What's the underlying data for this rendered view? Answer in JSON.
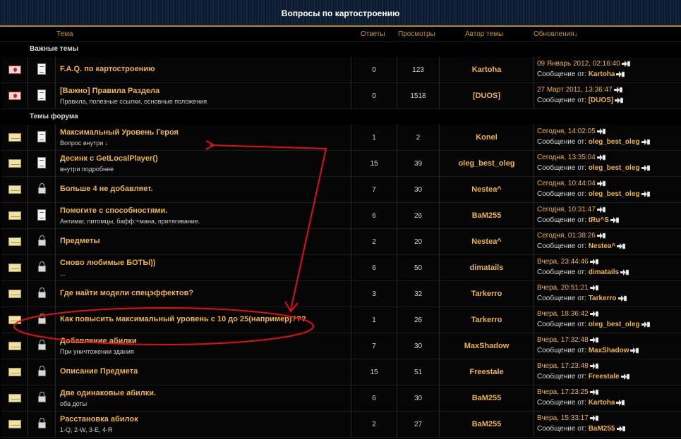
{
  "banner": {
    "title": "Вопросы по картостроению"
  },
  "columns": {
    "topic": "Тема",
    "replies": "Ответы",
    "views": "Просмотры",
    "author": "Автор темы",
    "updates": "Обновления↓"
  },
  "sections": {
    "important": "Важные темы",
    "forum": "Темы форума"
  },
  "important_topics": [
    {
      "title": "F.A.Q. по картостроению",
      "desc": "",
      "replies": "0",
      "views": "123",
      "author": "Kartoha",
      "updated": "09 Январь 2012, 02:16:40",
      "msg_prefix": "Сообщение от:",
      "msg_author": "Kartoha"
    },
    {
      "title": "[Важно] Правила Раздела",
      "desc": "Правила, полезные ссылки, основные положения",
      "replies": "0",
      "views": "1518",
      "author": "[DUOS]",
      "updated": "27 Март 2011, 13:36:47",
      "msg_prefix": "Сообщение от:",
      "msg_author": "[DUOS]"
    }
  ],
  "forum_topics": [
    {
      "icon": "doc",
      "title": "Максимальный Уровень Героя",
      "desc": "Вопрос внутри ↓",
      "replies": "1",
      "views": "2",
      "author": "Konel",
      "updated": "Сегодня, 14:02:05",
      "msg_prefix": "Сообщение от:",
      "msg_author": "oleg_best_oleg"
    },
    {
      "icon": "doc",
      "title": "Десинк с GetLocalPlayer()",
      "desc": "внутри подробнее",
      "replies": "15",
      "views": "39",
      "author": "oleg_best_oleg",
      "updated": "Сегодня, 13:35:04",
      "msg_prefix": "Сообщение от:",
      "msg_author": "oleg_best_oleg"
    },
    {
      "icon": "lock",
      "title": "Больше 4 не добавляет.",
      "desc": "",
      "replies": "7",
      "views": "30",
      "author": "Nestea^",
      "updated": "Сегодня, 10:44:04",
      "msg_prefix": "Сообщение от:",
      "msg_author": "oleg_best_oleg"
    },
    {
      "icon": "doc",
      "title": "Помогите с способностями.",
      "desc": "Антимаг, питомцы, бафф:+мана, притягивание.",
      "replies": "6",
      "views": "26",
      "author": "BaM255",
      "updated": "Сегодня, 10:31:47",
      "msg_prefix": "Сообщение от:",
      "msg_author": "tRu^S"
    },
    {
      "icon": "lock",
      "title": "Предметы",
      "desc": "",
      "replies": "2",
      "views": "20",
      "author": "Nestea^",
      "updated": "Сегодня, 01:38:26",
      "msg_prefix": "Сообщение от:",
      "msg_author": "Nestea^"
    },
    {
      "icon": "lock",
      "title": "Сново любимые БОТЫ))",
      "desc": "...",
      "replies": "6",
      "views": "50",
      "author": "dimatails",
      "updated": "Вчера, 23:44:46",
      "msg_prefix": "Сообщение от:",
      "msg_author": "dimatails"
    },
    {
      "icon": "lock",
      "title": "Где найти модели спецэффектов?",
      "desc": "",
      "replies": "3",
      "views": "32",
      "author": "Tarkerro",
      "updated": "Вчера, 20:51:21",
      "msg_prefix": "Сообщение от:",
      "msg_author": "Tarkerro"
    },
    {
      "icon": "lock",
      "title": "Как повысить максимальный уровень с 10 до 25(например)???",
      "desc": "",
      "replies": "1",
      "views": "26",
      "author": "Tarkerro",
      "updated": "Вчера, 18:36:42",
      "msg_prefix": "Сообщение от:",
      "msg_author": "oleg_best_oleg"
    },
    {
      "icon": "lock",
      "title": "Добавление абилки",
      "desc": "При уничтожении здания",
      "replies": "7",
      "views": "30",
      "author": "MaxShadow",
      "updated": "Вчера, 17:32:48",
      "msg_prefix": "Сообщение от:",
      "msg_author": "MaxShadow"
    },
    {
      "icon": "lock",
      "title": "Описание Предмета",
      "desc": "",
      "replies": "15",
      "views": "51",
      "author": "Freestale",
      "updated": "Вчера, 17:23:48",
      "msg_prefix": "Сообщение от:",
      "msg_author": "Freestale"
    },
    {
      "icon": "lock",
      "title": "Две одинаковые абилки.",
      "desc": "оба доты",
      "replies": "6",
      "views": "30",
      "author": "BaM255",
      "updated": "Вчера, 17:23:25",
      "msg_prefix": "Сообщение от:",
      "msg_author": "Kartoha"
    },
    {
      "icon": "lock",
      "title": "Расстановка абилок",
      "desc": "1-Q, 2-W, 3-E, 4-R",
      "replies": "2",
      "views": "27",
      "author": "BaM255",
      "updated": "Вчера, 15:33:17",
      "msg_prefix": "Сообщение от:",
      "msg_author": "BaM255"
    }
  ],
  "colors": {
    "accent": "#f0b63a",
    "annotation": "#e01010",
    "background": "#000000"
  }
}
